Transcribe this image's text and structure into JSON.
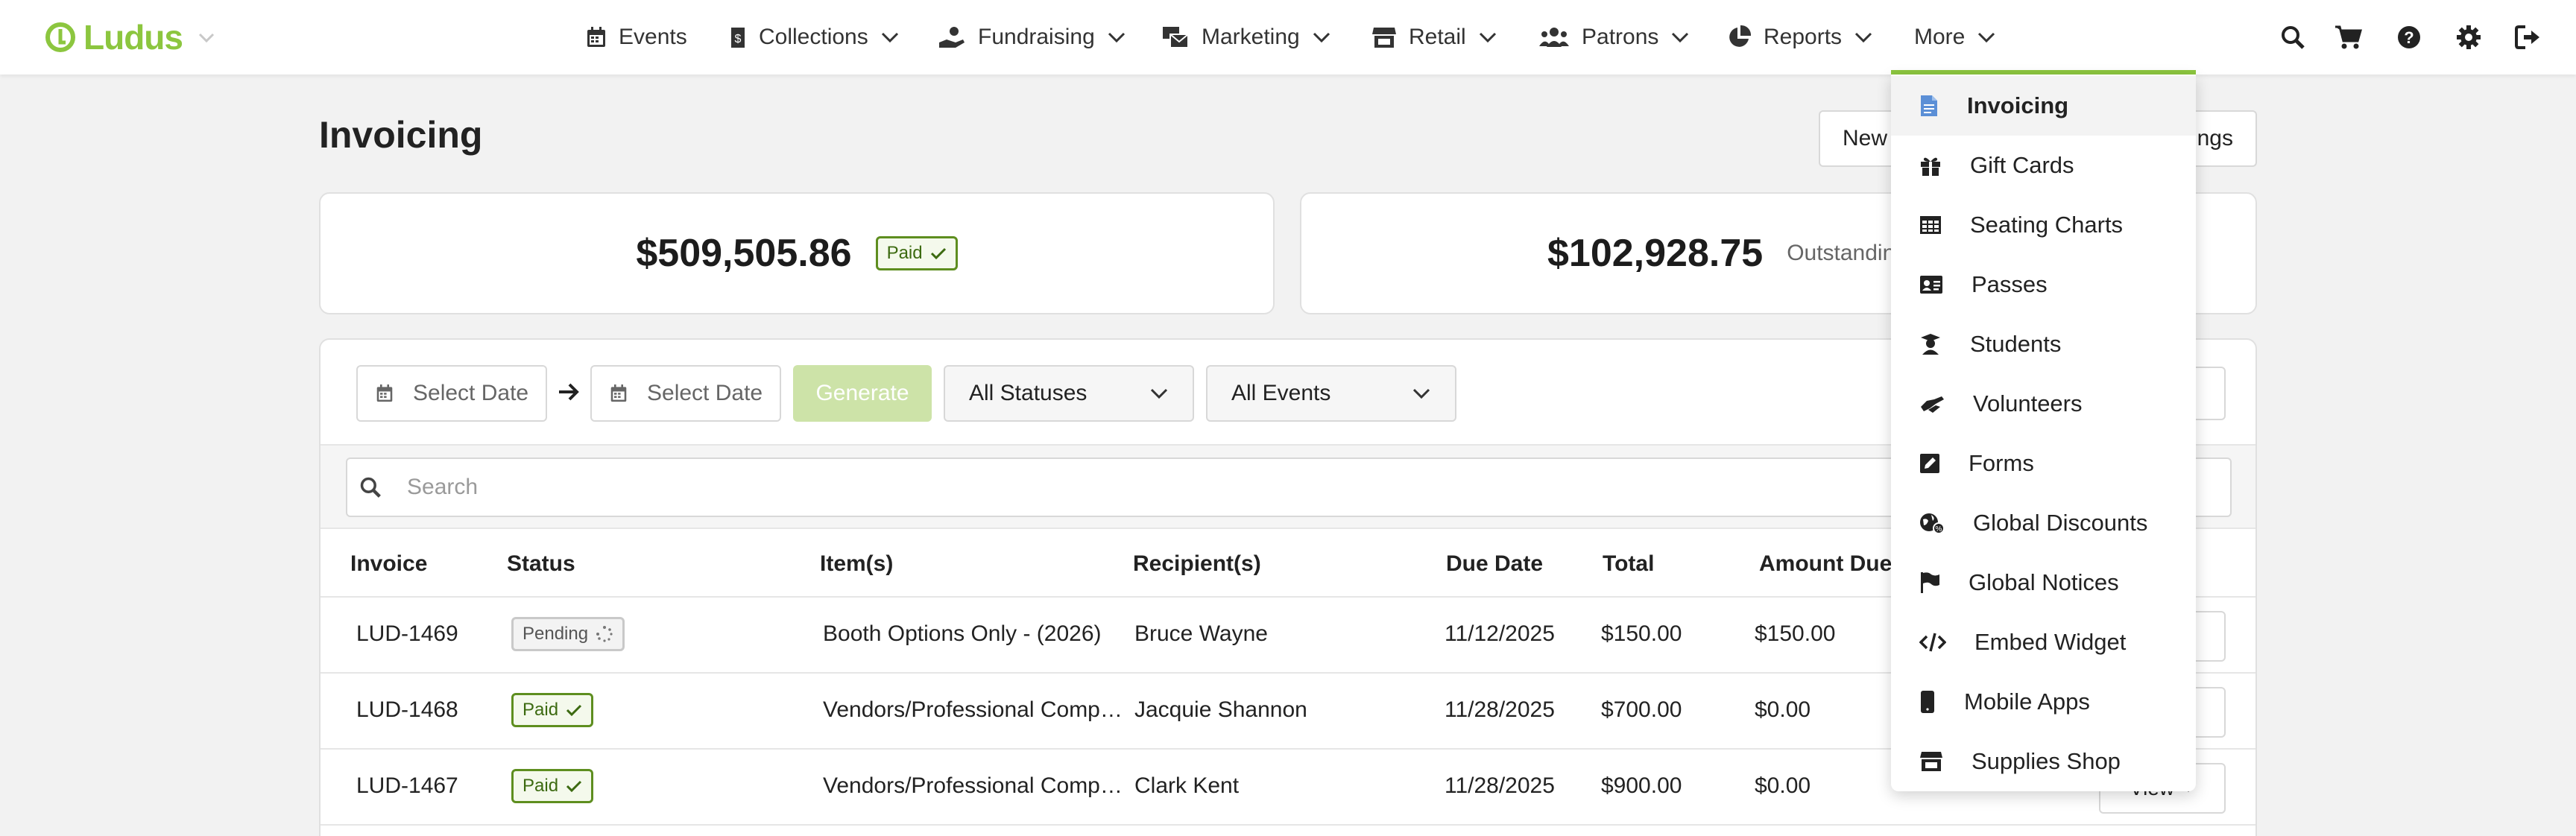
{
  "brand": {
    "name": "Ludus",
    "accent": "#8cc63f"
  },
  "nav": {
    "items": [
      {
        "label": "Events",
        "icon": "calendar-icon"
      },
      {
        "label": "Collections",
        "icon": "money-bag-icon"
      },
      {
        "label": "Fundraising",
        "icon": "hand-donate-icon"
      },
      {
        "label": "Marketing",
        "icon": "mail-bulk-icon"
      },
      {
        "label": "Retail",
        "icon": "store-icon"
      },
      {
        "label": "Patrons",
        "icon": "users-icon"
      },
      {
        "label": "Reports",
        "icon": "pie-chart-icon"
      },
      {
        "label": "More"
      }
    ],
    "utility_icons": [
      "search-icon",
      "cart-icon",
      "help-icon",
      "gear-icon",
      "logout-icon"
    ]
  },
  "page": {
    "title": "Invoicing",
    "new_button": "New",
    "settings_button": "ngs"
  },
  "stats": {
    "paid_total": "$509,505.86",
    "paid_badge": "Paid",
    "outstanding_total": "$102,928.75",
    "outstanding_label": "Outstanding"
  },
  "filters": {
    "start_date_placeholder": "Select Date",
    "end_date_placeholder": "Select Date",
    "generate_label": "Generate",
    "status_select": "All Statuses",
    "event_select": "All Events",
    "search_placeholder": "Search"
  },
  "table": {
    "columns": [
      "Invoice",
      "Status",
      "Item(s)",
      "Recipient(s)",
      "Due Date",
      "Total",
      "Amount Due"
    ],
    "rows": [
      {
        "invoice": "LUD-1469",
        "status": "Pending",
        "items": "Booth Options Only - (2026)",
        "recipient": "Bruce Wayne",
        "due": "11/12/2025",
        "total": "$150.00",
        "amount_due": "$150.00"
      },
      {
        "invoice": "LUD-1468",
        "status": "Paid",
        "items": "Vendors/Professional Companies",
        "recipient": "Jacquie Shannon",
        "due": "11/28/2025",
        "total": "$700.00",
        "amount_due": "$0.00"
      },
      {
        "invoice": "LUD-1467",
        "status": "Paid",
        "items": "Vendors/Professional Companies",
        "recipient": "Clark Kent",
        "due": "11/28/2025",
        "total": "$900.00",
        "amount_due": "$0.00",
        "view": "View"
      }
    ]
  },
  "more_menu": {
    "items": [
      {
        "label": "Invoicing",
        "icon": "invoice-icon",
        "active": true
      },
      {
        "label": "Gift Cards",
        "icon": "gift-icon"
      },
      {
        "label": "Seating Charts",
        "icon": "grid-icon"
      },
      {
        "label": "Passes",
        "icon": "id-card-icon"
      },
      {
        "label": "Students",
        "icon": "graduate-icon"
      },
      {
        "label": "Volunteers",
        "icon": "helping-hands-icon"
      },
      {
        "label": "Forms",
        "icon": "form-icon"
      },
      {
        "label": "Global Discounts",
        "icon": "globe-discount-icon"
      },
      {
        "label": "Global Notices",
        "icon": "flag-icon"
      },
      {
        "label": "Embed Widget",
        "icon": "code-icon"
      },
      {
        "label": "Mobile Apps",
        "icon": "mobile-icon"
      },
      {
        "label": "Supplies Shop",
        "icon": "shop-icon"
      }
    ]
  }
}
